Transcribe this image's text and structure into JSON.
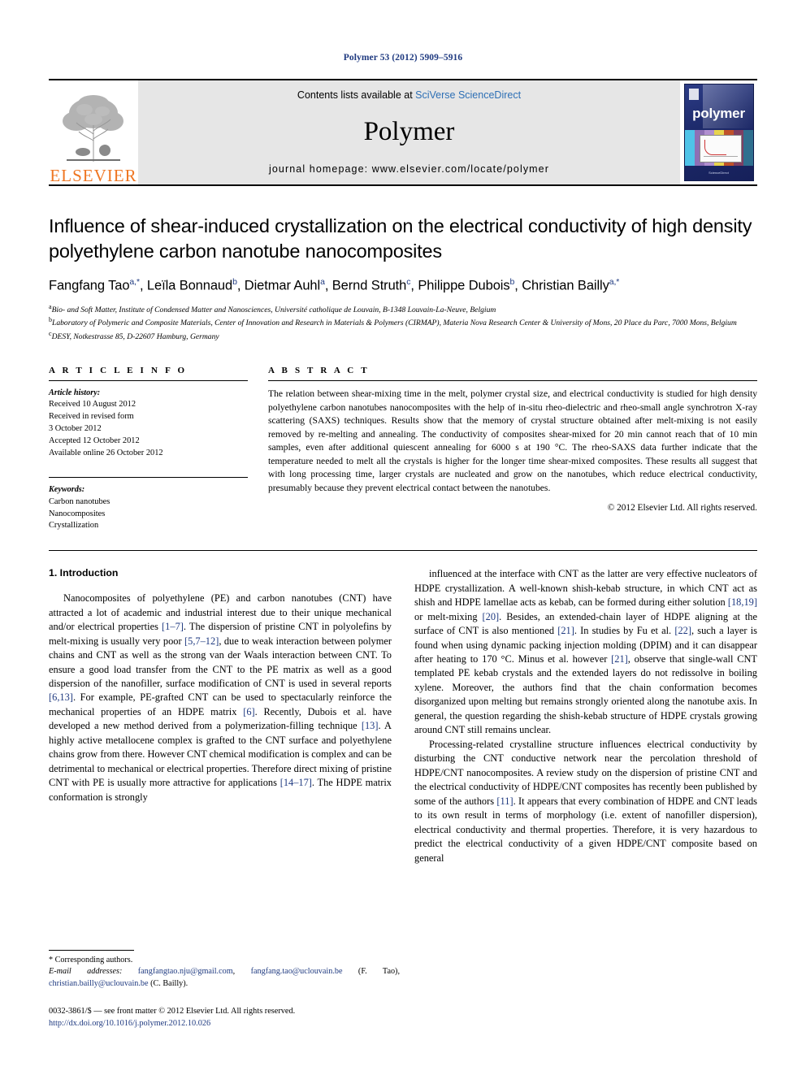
{
  "running_head": "Polymer 53 (2012) 5909–5916",
  "banner": {
    "publisher_logo_text": "ELSEVIER",
    "contents_prefix": "Contents lists available at ",
    "contents_link": "SciVerse ScienceDirect",
    "journal_title": "Polymer",
    "homepage": "journal homepage: www.elsevier.com/locate/polymer",
    "cover_title": "polymer",
    "cover_footer": "ScienceDirect"
  },
  "article": {
    "title": "Influence of shear-induced crystallization on the electrical conductivity of high density polyethylene carbon nanotube nanocomposites",
    "authors_html": "Fangfang Tao<sup>a,*</sup>, Leïla Bonnaud<sup>b</sup>, Dietmar Auhl<sup>a</sup>, Bernd Struth<sup>c</sup>, Philippe Dubois<sup>b</sup>, Christian Bailly<sup>a,*</sup>",
    "affiliations": [
      "Bio- and Soft Matter, Institute of Condensed Matter and Nanosciences, Université catholique de Louvain, B-1348 Louvain-La-Neuve, Belgium",
      "Laboratory of Polymeric and Composite Materials, Center of Innovation and Research in Materials & Polymers (CIRMAP), Materia Nova Research Center & University of Mons, 20 Place du Parc, 7000 Mons, Belgium",
      "DESY, Notkestrasse 85, D-22607 Hamburg, Germany"
    ],
    "affiliation_marks": [
      "a",
      "b",
      "c"
    ]
  },
  "article_info": {
    "heading": "A R T I C L E  I N F O",
    "history_label": "Article history:",
    "history": [
      "Received 10 August 2012",
      "Received in revised form",
      "3 October 2012",
      "Accepted 12 October 2012",
      "Available online 26 October 2012"
    ],
    "keywords_label": "Keywords:",
    "keywords": [
      "Carbon nanotubes",
      "Nanocomposites",
      "Crystallization"
    ]
  },
  "abstract": {
    "heading": "A B S T R A C T",
    "text": "The relation between shear-mixing time in the melt, polymer crystal size, and electrical conductivity is studied for high density polyethylene carbon nanotubes nanocomposites with the help of in-situ rheo-dielectric and rheo-small angle synchrotron X-ray scattering (SAXS) techniques. Results show that the memory of crystal structure obtained after melt-mixing is not easily removed by re-melting and annealing. The conductivity of composites shear-mixed for 20 min cannot reach that of 10 min samples, even after additional quiescent annealing for 6000 s at 190 °C. The rheo-SAXS data further indicate that the temperature needed to melt all the crystals is higher for the longer time shear-mixed composites. These results all suggest that with long processing time, larger crystals are nucleated and grow on the nanotubes, which reduce electrical conductivity, presumably because they prevent electrical contact between the nanotubes.",
    "copyright": "© 2012 Elsevier Ltd. All rights reserved."
  },
  "body": {
    "section_number_title": "1.  Introduction",
    "left_paragraphs": [
      "Nanocomposites of polyethylene (PE) and carbon nanotubes (CNT) have attracted a lot of academic and industrial interest due to their unique mechanical and/or electrical properties [1–7]. The dispersion of pristine CNT in polyolefins by melt-mixing is usually very poor [5,7–12], due to weak interaction between polymer chains and CNT as well as the strong van der Waals interaction between CNT. To ensure a good load transfer from the CNT to the PE matrix as well as a good dispersion of the nanofiller, surface modification of CNT is used in several reports [6,13]. For example, PE-grafted CNT can be used to spectacularly reinforce the mechanical properties of an HDPE matrix [6]. Recently, Dubois et al. have developed a new method derived from a polymerization-filling technique [13]. A highly active metallocene complex is grafted to the CNT surface and polyethylene chains grow from there. However CNT chemical modification is complex and can be detrimental to mechanical or electrical properties. Therefore direct mixing of pristine CNT with PE is usually more attractive for applications [14–17]. The HDPE matrix conformation is strongly"
    ],
    "right_paragraphs": [
      "influenced at the interface with CNT as the latter are very effective nucleators of HDPE crystallization. A well-known shish-kebab structure, in which CNT act as shish and HDPE lamellae acts as kebab, can be formed during either solution [18,19] or melt-mixing [20]. Besides, an extended-chain layer of HDPE aligning at the surface of CNT is also mentioned [21]. In studies by Fu et al. [22], such a layer is found when using dynamic packing injection molding (DPIM) and it can disappear after heating to 170 °C. Minus et al. however [21], observe that single-wall CNT templated PE kebab crystals and the extended layers do not redissolve in boiling xylene. Moreover, the authors find that the chain conformation becomes disorganized upon melting but remains strongly oriented along the nanotube axis. In general, the question regarding the shish-kebab structure of HDPE crystals growing around CNT still remains unclear.",
      "Processing-related crystalline structure influences electrical conductivity by disturbing the CNT conductive network near the percolation threshold of HDPE/CNT nanocomposites. A review study on the dispersion of pristine CNT and the electrical conductivity of HDPE/CNT composites has recently been published by some of the authors [11]. It appears that every combination of HDPE and CNT leads to its own result in terms of morphology (i.e. extent of nanofiller dispersion), electrical conductivity and thermal properties. Therefore, it is very hazardous to predict the electrical conductivity of a given HDPE/CNT composite based on general"
    ]
  },
  "footnotes": {
    "corresponding": "* Corresponding authors.",
    "email_label": "E-mail addresses:",
    "emails": [
      "fangfangtao.nju@gmail.com",
      "fangfang.tao@uclouvain.be"
    ],
    "email_owner_1": "(F. Tao),",
    "email_3": "christian.bailly@uclouvain.be",
    "email_owner_2": "(C. Bailly).",
    "imprint": "0032-3861/$ — see front matter © 2012 Elsevier Ltd. All rights reserved.",
    "doi": "http://dx.doi.org/10.1016/j.polymer.2012.10.026"
  },
  "colors": {
    "link_blue": "#2d6fb5",
    "ref_blue": "#1f3a80",
    "elsevier_orange": "#ef7622",
    "banner_gray": "#e6e6e6"
  }
}
